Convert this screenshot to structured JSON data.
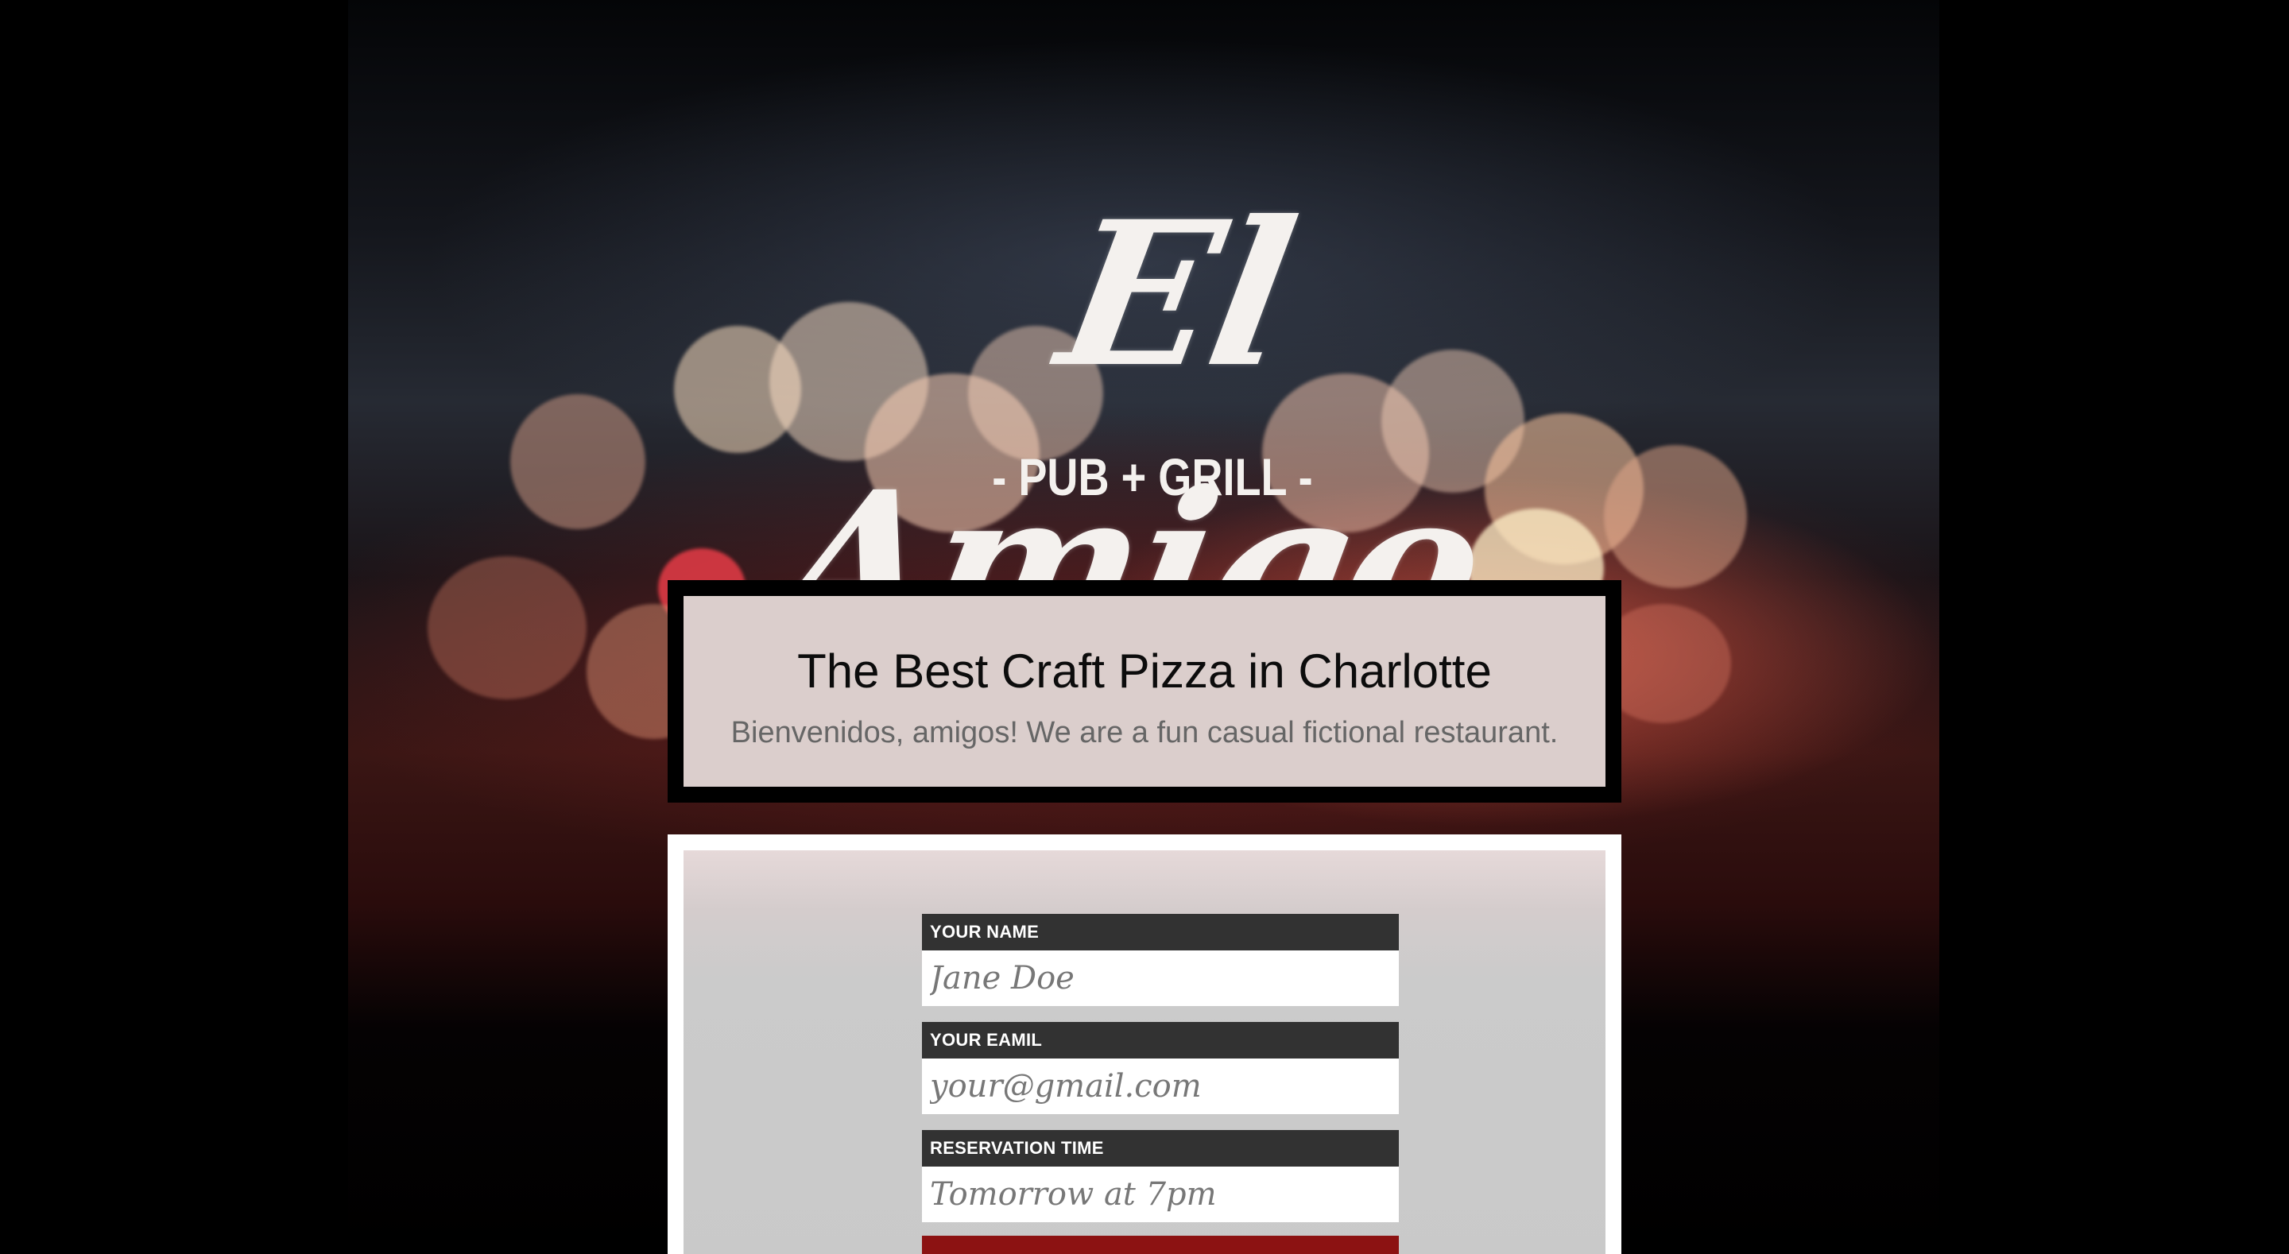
{
  "brand": {
    "logo_name": "El Amigo",
    "logo_tagline": "- PUB + GRILL -"
  },
  "hero": {
    "title": "The Best Craft Pizza in Charlotte",
    "subtitle": "Bienvenidos, amigos! We are a fun casual fictional restaurant."
  },
  "form": {
    "name_label": "YOUR NAME",
    "name_placeholder": "Jane Doe",
    "email_label": "YOUR EAMIL",
    "email_placeholder": "your@gmail.com",
    "time_label": "RESERVATION TIME",
    "time_placeholder": "Tomorrow at 7pm",
    "submit_label": ""
  },
  "colors": {
    "background": "#000000",
    "label_bar": "#323232",
    "submit": "#8c1212",
    "panel": "#c9c9c9"
  }
}
